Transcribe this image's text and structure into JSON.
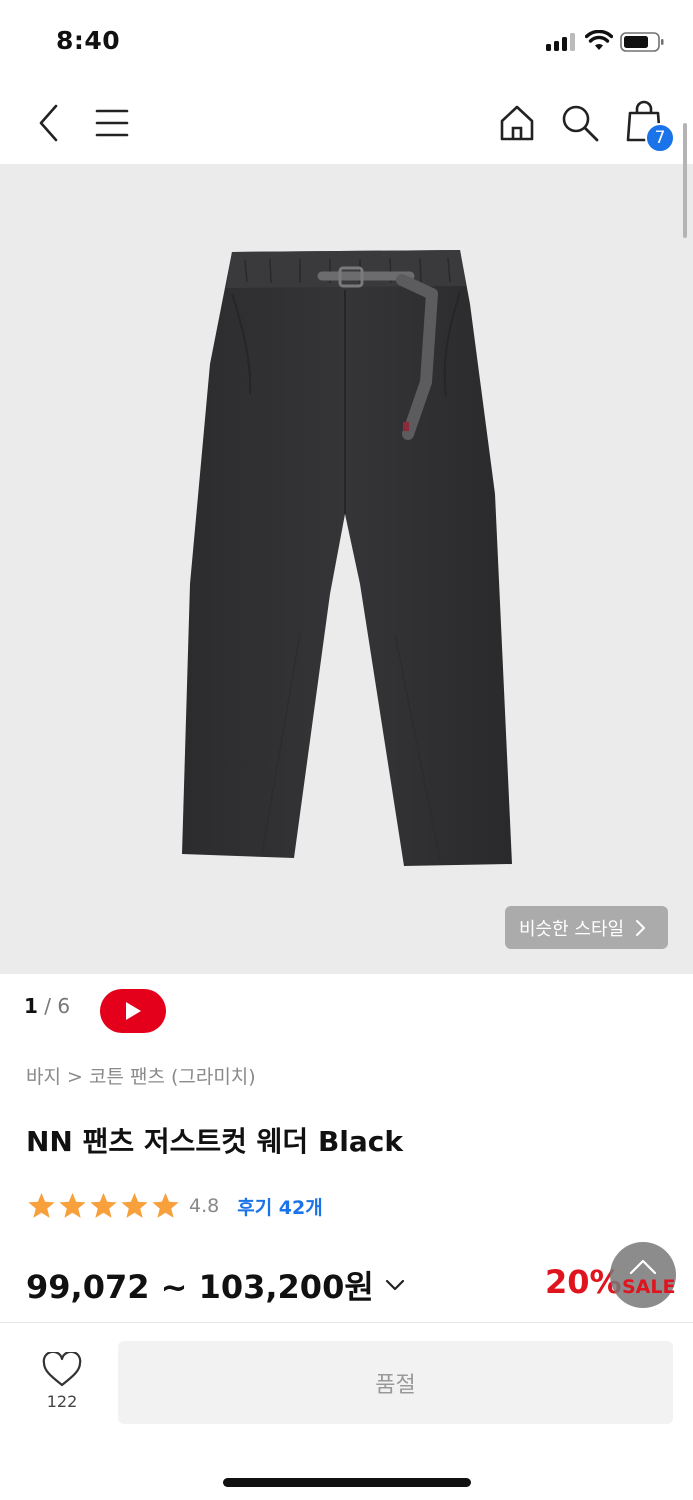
{
  "status_bar": {
    "time": "8:40"
  },
  "nav": {
    "back_icon": "chevron-left-icon",
    "menu_icon": "hamburger-menu-icon",
    "home_icon": "home-icon",
    "search_icon": "search-icon",
    "cart_icon": "shopping-bag-icon",
    "cart_count": "7"
  },
  "gallery": {
    "similar_style_label": "비슷한 스타일",
    "current_page": "1",
    "page_separator": "/",
    "total_pages": "6",
    "video_icon": "youtube-play-icon"
  },
  "product": {
    "breadcrumb": "바지 > 코튼 팬츠 (그라미치)",
    "title": "NN 팬츠 저스트컷 웨더 Black",
    "rating_value": "4.8",
    "rating_stars": 4.8,
    "review_label": "후기 42개",
    "price_range": "99,072 ~ 103,200원",
    "discount": "20%",
    "sale_label": "SALE"
  },
  "bottom_bar": {
    "wish_count": "122",
    "soldout_label": "품절"
  },
  "colors": {
    "accent_blue": "#1a73e8",
    "sale_red": "#e0141e",
    "youtube_red": "#e4001b",
    "star_orange": "#f7a03c",
    "image_bg": "#ebebeb"
  }
}
